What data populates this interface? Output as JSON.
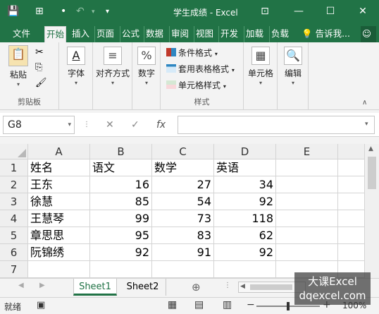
{
  "window": {
    "title": "学生成绩 - Excel"
  },
  "ribbon_tabs": [
    "文件",
    "开始",
    "插入",
    "页面",
    "公式",
    "数据",
    "审阅",
    "视图",
    "开发",
    "加载",
    "负载"
  ],
  "tell_me": "告诉我...",
  "ribbon": {
    "clipboard": {
      "paste": "粘贴",
      "group": "剪贴板"
    },
    "font": {
      "label": "字体"
    },
    "alignment": {
      "label": "对齐方式"
    },
    "number": {
      "label": "数字"
    },
    "styles": {
      "conditional": "条件格式",
      "table": "套用表格格式",
      "cell_styles": "单元格样式",
      "group": "样式"
    },
    "cells": {
      "label": "单元格"
    },
    "editing": {
      "label": "编辑"
    }
  },
  "formula_bar": {
    "name_box": "G8",
    "fx": "fx"
  },
  "sheet": {
    "columns": [
      "A",
      "B",
      "C",
      "D",
      "E"
    ],
    "rows": [
      {
        "num": "1",
        "A": "姓名",
        "B": "语文",
        "C": "数学",
        "D": "英语"
      },
      {
        "num": "2",
        "A": "王东",
        "B": "16",
        "C": "27",
        "D": "34"
      },
      {
        "num": "3",
        "A": "徐慧",
        "B": "85",
        "C": "54",
        "D": "92"
      },
      {
        "num": "4",
        "A": "王慧琴",
        "B": "99",
        "C": "73",
        "D": "118"
      },
      {
        "num": "5",
        "A": "章思思",
        "B": "95",
        "C": "83",
        "D": "62"
      },
      {
        "num": "6",
        "A": "阮锦绣",
        "B": "92",
        "C": "91",
        "D": "92"
      },
      {
        "num": "7",
        "A": "",
        "B": "",
        "C": "",
        "D": ""
      }
    ]
  },
  "sheet_tabs": [
    "Sheet1",
    "Sheet2"
  ],
  "status": {
    "ready": "就绪",
    "zoom": "100%"
  },
  "watermark": {
    "line1": "大课Excel",
    "line2": "dqexcel.com"
  },
  "colors": {
    "accent": "#217346"
  }
}
